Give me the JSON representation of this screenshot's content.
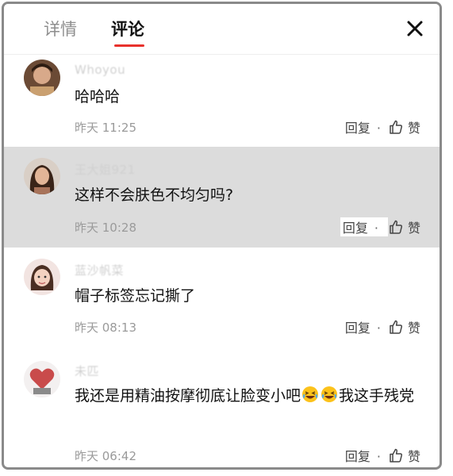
{
  "tabs": {
    "details": "详情",
    "comments": "评论"
  },
  "actions": {
    "reply": "回复",
    "separator": "·",
    "like": "赞"
  },
  "colors": {
    "accent": "#e8312c",
    "highlight_row": "#dcdcdc"
  },
  "icons": {
    "close": "close-icon",
    "like": "thumbs-up-icon",
    "emoji": "laughing-crying-emoji-icon"
  },
  "comments": [
    {
      "username": "Whoyou",
      "content": "哈哈哈",
      "time": "昨天 11:25",
      "highlighted": false
    },
    {
      "username": "王大姐921",
      "content": "这样不会肤色不均匀吗?",
      "time": "昨天 10:28",
      "highlighted": true
    },
    {
      "username": "蓝沙帆菜",
      "content": "帽子标签忘记撕了",
      "time": "昨天 08:13",
      "highlighted": false
    },
    {
      "username": "未匹",
      "content_before": "我还是用精油按摩彻底让脸变小吧",
      "content_after": "我这手残党",
      "time": "昨天 06:42",
      "highlighted": false
    }
  ]
}
